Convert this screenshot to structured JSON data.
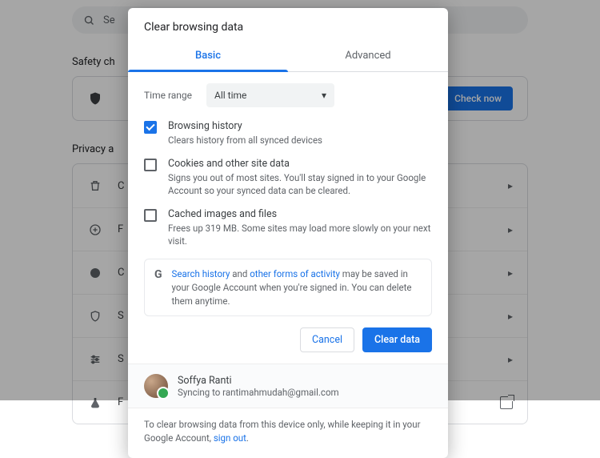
{
  "background": {
    "search_placeholder": "Se",
    "safety_label": "Safety ch",
    "check_now": "Check now",
    "privacy_label": "Privacy a",
    "rows_letters": [
      "C",
      "F",
      "C",
      "S",
      "S",
      "F"
    ]
  },
  "dialog": {
    "title": "Clear browsing data",
    "tabs": {
      "basic": "Basic",
      "advanced": "Advanced"
    },
    "time_range_label": "Time range",
    "time_range_value": "All time",
    "options": [
      {
        "checked": true,
        "title": "Browsing history",
        "desc": "Clears history from all synced devices"
      },
      {
        "checked": false,
        "title": "Cookies and other site data",
        "desc": "Signs you out of most sites. You'll stay signed in to your Google Account so your synced data can be cleared."
      },
      {
        "checked": false,
        "title": "Cached images and files",
        "desc": "Frees up 319 MB. Some sites may load more slowly on your next visit."
      }
    ],
    "notice": {
      "link1": "Search history",
      "mid1": " and ",
      "link2": "other forms of activity",
      "tail": " may be saved in your Google Account when you're signed in. You can delete them anytime."
    },
    "actions": {
      "cancel": "Cancel",
      "clear": "Clear data"
    },
    "account": {
      "name": "Soffya Ranti",
      "status_prefix": "Syncing to ",
      "email": "rantimahmudah@gmail.com"
    },
    "signout": {
      "pre": "To clear browsing data from this device only, while keeping it in your Google Account, ",
      "link": "sign out",
      "post": "."
    }
  }
}
